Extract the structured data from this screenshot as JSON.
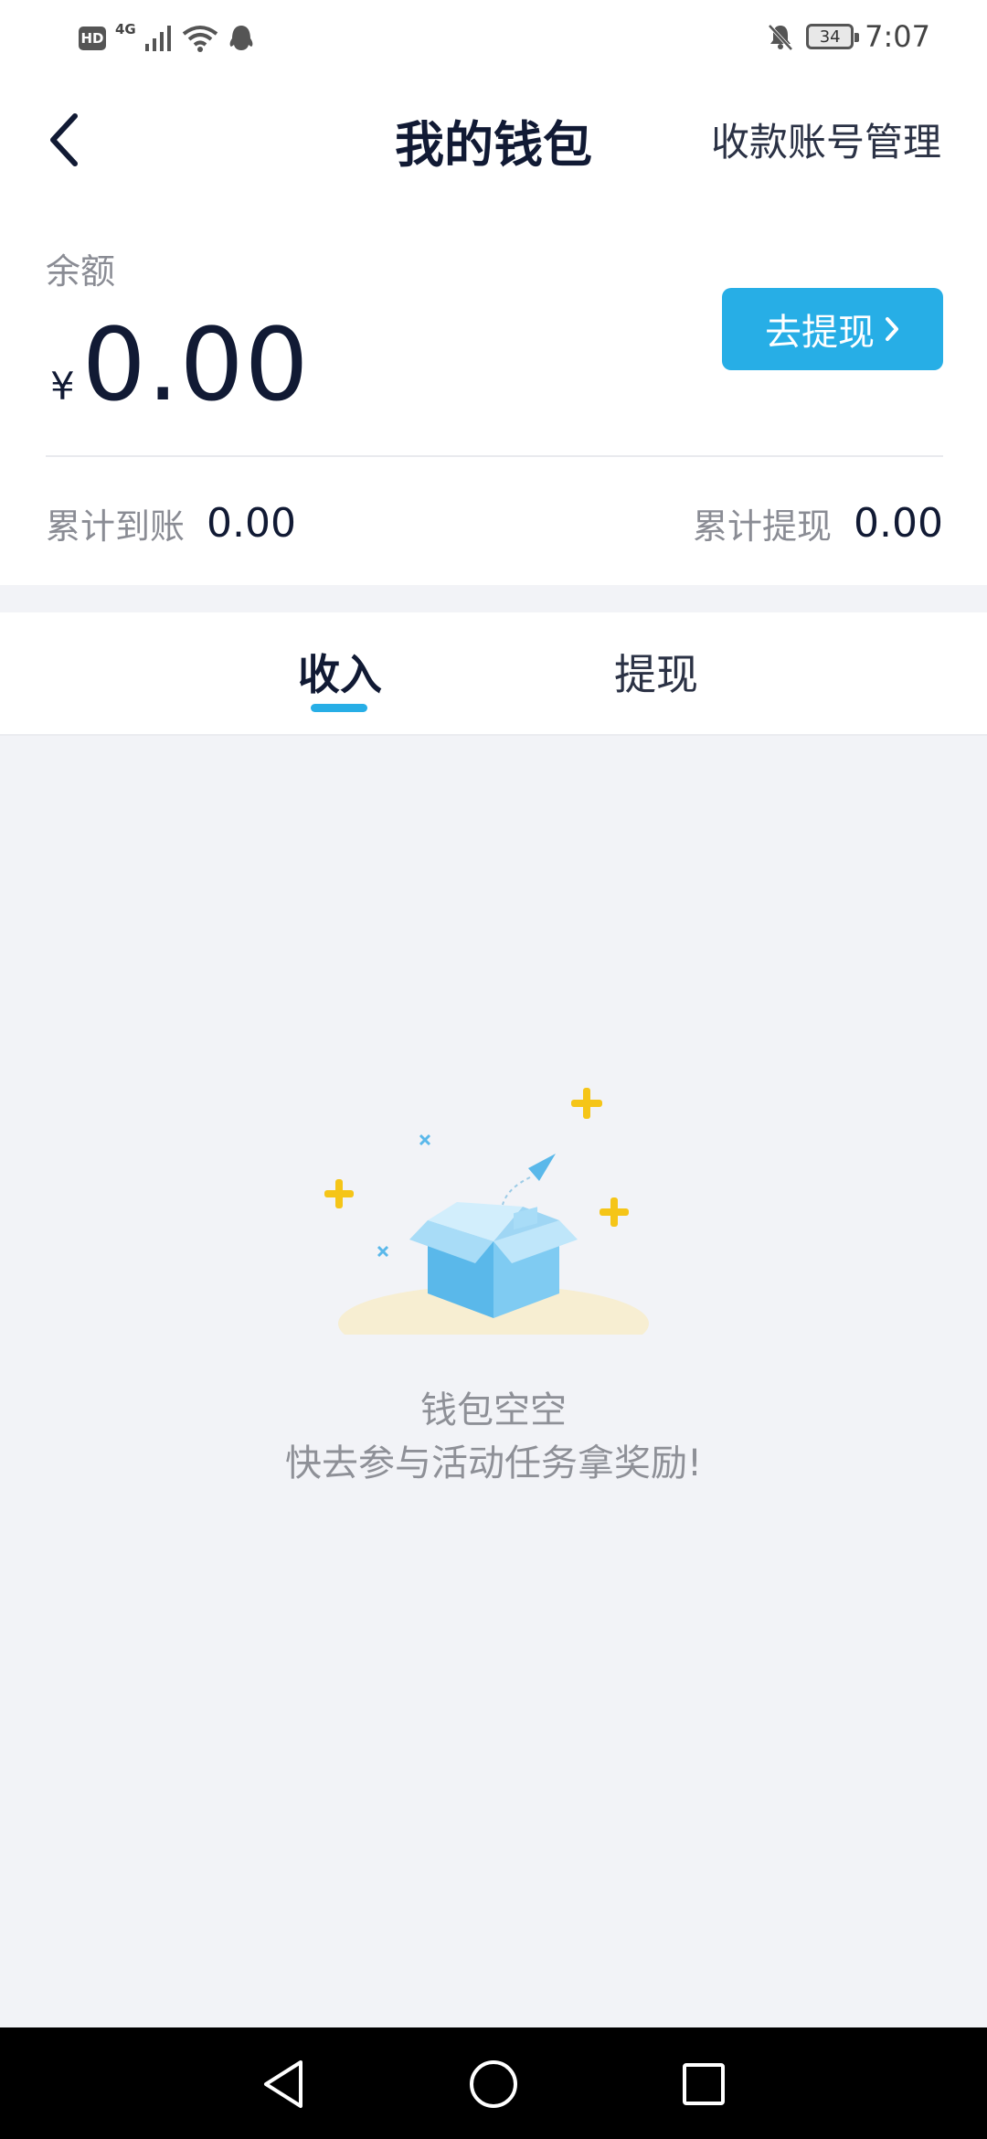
{
  "status_bar": {
    "hd": "HD",
    "network": "4G",
    "battery": "34",
    "time": "7:07",
    "icons": [
      "hd-icon",
      "signal-icon",
      "wifi-icon",
      "qq-notification-icon",
      "mute-icon",
      "battery-icon"
    ]
  },
  "header": {
    "title": "我的钱包",
    "right_action": "收款账号管理",
    "back_icon": "chevron-left-icon"
  },
  "balance": {
    "label": "余额",
    "currency": "¥",
    "amount": "0.00",
    "withdraw_button": "去提现",
    "total_received_label": "累计到账",
    "total_received_value": "0.00",
    "total_withdrawn_label": "累计提现",
    "total_withdrawn_value": "0.00"
  },
  "tabs": [
    {
      "label": "收入",
      "active": true
    },
    {
      "label": "提现",
      "active": false
    }
  ],
  "empty_state": {
    "title": "钱包空空",
    "subtitle": "快去参与活动任务拿奖励!"
  },
  "colors": {
    "accent": "#27aee6",
    "text_primary": "#111a34",
    "text_secondary": "#8a8c94",
    "background": "#f2f3f7",
    "sparkle": "#f5c518"
  }
}
